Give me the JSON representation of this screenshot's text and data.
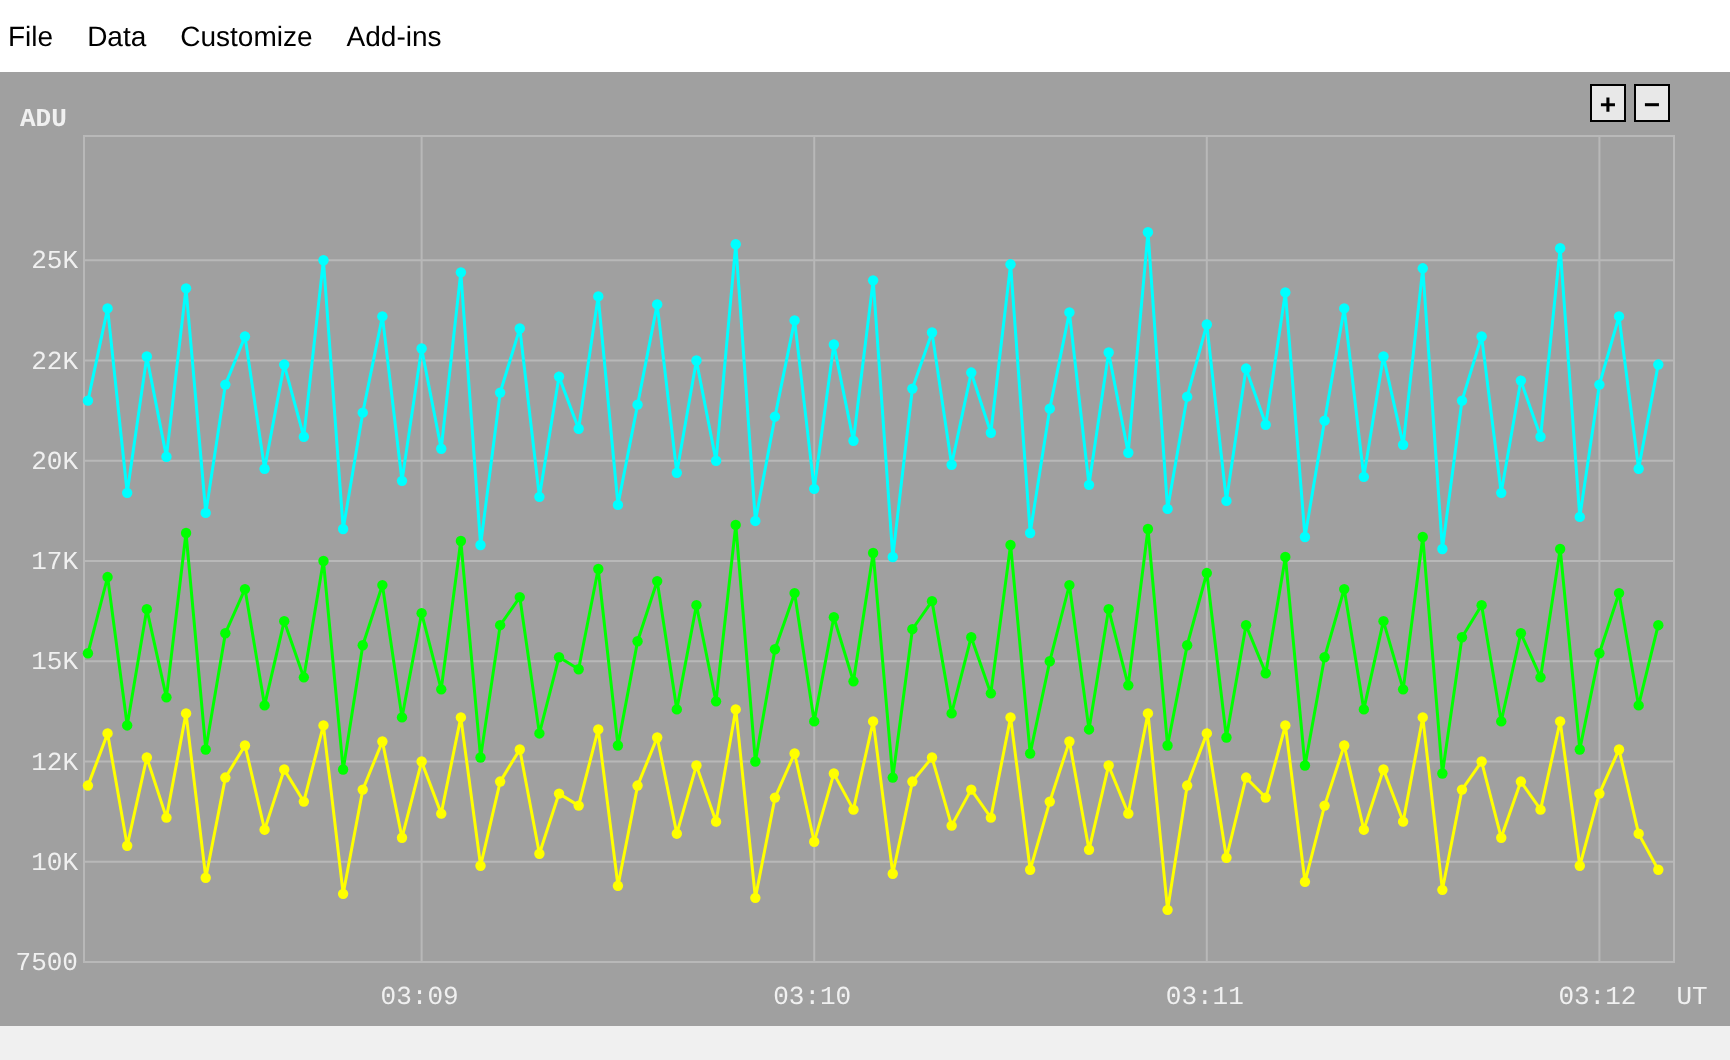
{
  "menu": [
    "File",
    "Data",
    "Customize",
    "Add-ins"
  ],
  "chart": {
    "zoom_buttons": [
      "+",
      "−"
    ],
    "chart_data": {
      "type": "line",
      "grid": true,
      "xlabel": "UT",
      "ylabel": "ADU",
      "categories": [
        null,
        null,
        null,
        null,
        null,
        null,
        null,
        null,
        null,
        null,
        null,
        null,
        null,
        null,
        null,
        null,
        null,
        "03:09",
        null,
        null,
        null,
        null,
        null,
        null,
        null,
        null,
        null,
        null,
        null,
        null,
        null,
        null,
        null,
        null,
        null,
        null,
        null,
        "03:10",
        null,
        null,
        null,
        null,
        null,
        null,
        null,
        null,
        null,
        null,
        null,
        null,
        null,
        null,
        null,
        null,
        null,
        null,
        null,
        "03:11",
        null,
        null,
        null,
        null,
        null,
        null,
        null,
        null,
        null,
        null,
        null,
        null,
        null,
        null,
        null,
        null,
        null,
        null,
        null,
        "03:12",
        null,
        null,
        null
      ],
      "series": [
        {
          "color": "#ffff00",
          "marker": "circle",
          "values": [
            11900,
            13200,
            10400,
            12600,
            11100,
            13700,
            9600,
            12100,
            12900,
            10800,
            12300,
            11500,
            13400,
            9200,
            11800,
            13000,
            10600,
            12500,
            11200,
            13600,
            9900,
            12000,
            12800,
            10200,
            11700,
            11400,
            13300,
            9400,
            11900,
            13100,
            10700,
            12400,
            11000,
            13800,
            9100,
            11600,
            12700,
            10500,
            12200,
            11300,
            13500,
            9700,
            12000,
            12600,
            10900,
            11800,
            11100,
            13600,
            9800,
            11500,
            13000,
            10300,
            12400,
            11200,
            13700,
            8800,
            11900,
            13200,
            10100,
            12100,
            11600,
            13400,
            9500,
            11400,
            12900,
            10800,
            12300,
            11000,
            13600,
            9300,
            11800,
            12500,
            10600,
            12000,
            11300,
            13500,
            9900,
            11700,
            12800,
            10700,
            9800
          ]
        },
        {
          "color": "#00ff00",
          "marker": "circle",
          "values": [
            15200,
            17100,
            13400,
            16300,
            14100,
            18200,
            12800,
            15700,
            16800,
            13900,
            16000,
            14600,
            17500,
            12300,
            15400,
            16900,
            13600,
            16200,
            14300,
            18000,
            12600,
            15900,
            16600,
            13200,
            15100,
            14800,
            17300,
            12900,
            15500,
            17000,
            13800,
            16400,
            14000,
            18400,
            12500,
            15300,
            16700,
            13500,
            16100,
            14500,
            17700,
            12100,
            15800,
            16500,
            13700,
            15600,
            14200,
            17900,
            12700,
            15000,
            16900,
            13300,
            16300,
            14400,
            18300,
            12900,
            15400,
            17200,
            13100,
            15900,
            14700,
            17600,
            12400,
            15100,
            16800,
            13800,
            16000,
            14300,
            18100,
            12200,
            15600,
            16400,
            13500,
            15700,
            14600,
            17800,
            12800,
            15200,
            16700,
            13900,
            15900
          ]
        },
        {
          "color": "#00ffff",
          "marker": "circle",
          "values": [
            21500,
            23800,
            19200,
            22600,
            20100,
            24300,
            18700,
            21900,
            23100,
            19800,
            22400,
            20600,
            25000,
            18300,
            21200,
            23600,
            19500,
            22800,
            20300,
            24700,
            17900,
            21700,
            23300,
            19100,
            22100,
            20800,
            24100,
            18900,
            21400,
            23900,
            19700,
            22500,
            20000,
            25400,
            18500,
            21100,
            23500,
            19300,
            22900,
            20500,
            24500,
            17600,
            21800,
            23200,
            19900,
            22200,
            20700,
            24900,
            18200,
            21300,
            23700,
            19400,
            22700,
            20200,
            25700,
            18800,
            21600,
            23400,
            19000,
            22300,
            20900,
            24200,
            18100,
            21000,
            23800,
            19600,
            22600,
            20400,
            24800,
            17800,
            21500,
            23100,
            19200,
            22000,
            20600,
            25300,
            18600,
            21900,
            23600,
            19800,
            22400
          ]
        }
      ],
      "ylim": [
        7500,
        28100
      ],
      "yticks": [
        {
          "value": 25000,
          "label": "25K"
        },
        {
          "value": 22500,
          "label": "22K"
        },
        {
          "value": 20000,
          "label": "20K"
        },
        {
          "value": 17500,
          "label": "17K"
        },
        {
          "value": 15000,
          "label": "15K"
        },
        {
          "value": 12500,
          "label": "12K"
        },
        {
          "value": 10000,
          "label": "10K"
        },
        {
          "value": 7500,
          "label": "7500"
        }
      ]
    }
  }
}
